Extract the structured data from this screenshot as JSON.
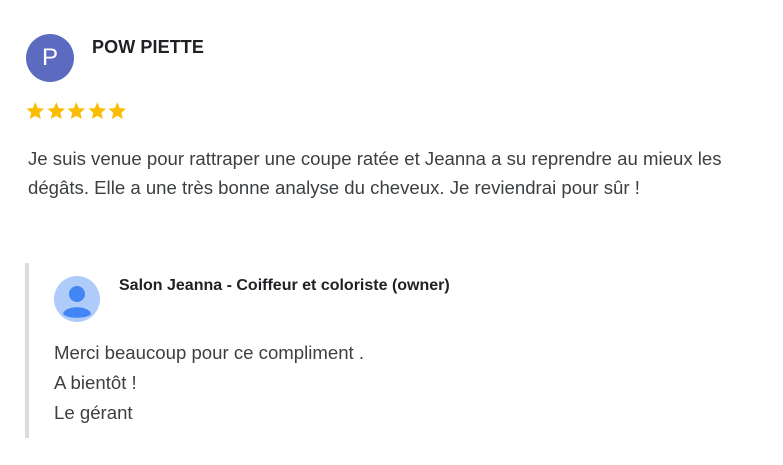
{
  "review": {
    "avatar_letter": "P",
    "reviewer_name": "POW PIETTE",
    "rating": 5,
    "text": "Je suis venue pour rattraper une coupe ratée et Jeanna a su reprendre au mieux les dégâts. Elle a une très bonne analyse du cheveux. Je reviendrai pour sûr !"
  },
  "reply": {
    "owner_name": "Salon Jeanna - Coiffeur et coloriste (owner)",
    "lines": [
      "Merci beaucoup pour ce compliment .",
      "A bientôt !",
      "Le gérant"
    ]
  },
  "colors": {
    "avatar_bg": "#5c6bc0",
    "star": "#fbbc04",
    "reply_bar": "#dadce0",
    "owner_avatar_bg": "#aecbfa",
    "owner_avatar_fg": "#4285f4"
  },
  "icons": {
    "star": "star-icon",
    "owner_avatar": "default-profile-icon"
  }
}
